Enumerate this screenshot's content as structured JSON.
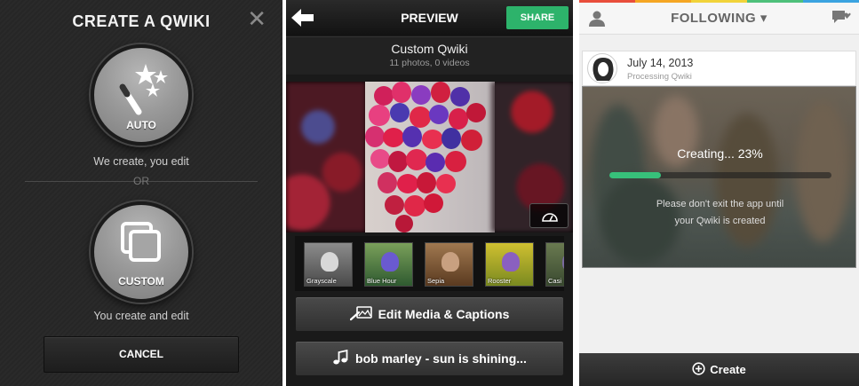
{
  "create_panel": {
    "title": "CREATE A QWIKI",
    "close_icon": "close-icon",
    "auto_label": "AUTO",
    "auto_caption": "We create, you edit",
    "or_text": "OR",
    "custom_label": "CUSTOM",
    "custom_caption": "You create and edit",
    "cancel_label": "CANCEL"
  },
  "preview_panel": {
    "title": "PREVIEW",
    "share_label": "SHARE",
    "qwiki_name": "Custom Qwiki",
    "qwiki_count": "11 photos, 0 videos",
    "filters": [
      {
        "name": "Grayscale"
      },
      {
        "name": "Blue Hour"
      },
      {
        "name": "Sepia"
      },
      {
        "name": "Rooster"
      },
      {
        "name": "Casi"
      }
    ],
    "edit_label": "Edit Media & Captions",
    "music_label": "bob marley - sun is shining...",
    "colors": {
      "share": "#2db36b"
    }
  },
  "following_panel": {
    "title": "FOLLOWING ▾",
    "date": "July 14, 2013",
    "status": "Processing Qwiki",
    "creating_text": "Creating...  23%",
    "progress": 0.23,
    "message_line1": "Please don't exit the app until",
    "message_line2": "your Qwiki is created",
    "create_label": "Create",
    "colors": {
      "progress": "#37c07a"
    }
  }
}
